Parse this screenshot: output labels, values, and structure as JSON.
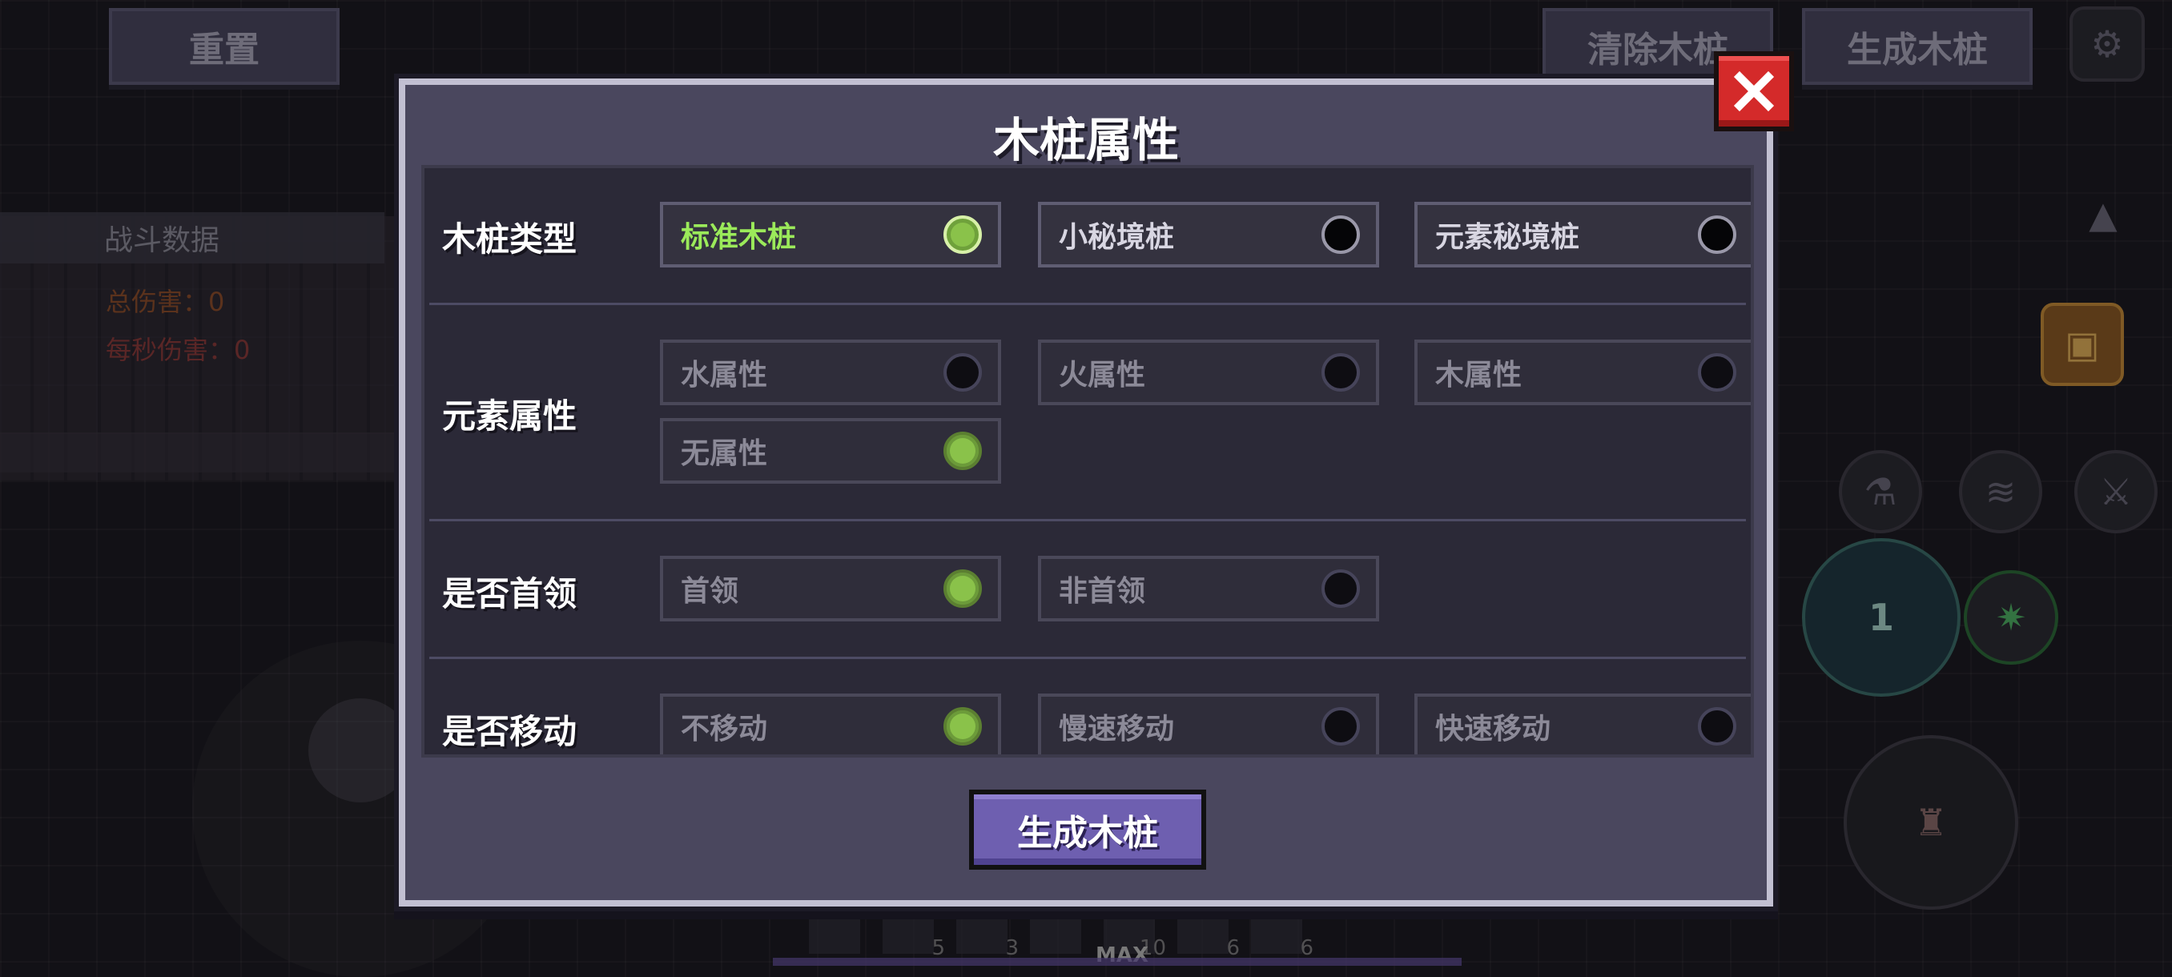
{
  "top_bar": {
    "reset_label": "重置",
    "clear_label": "清除木桩",
    "spawn_label": "生成木桩"
  },
  "stats": {
    "title": "战斗数据",
    "total_damage": "总伤害：0",
    "dps": "每秒伤害：0"
  },
  "hud": {
    "skill_level": "1",
    "hotbar_counts": [
      "5",
      "3",
      "10",
      "6",
      "6"
    ],
    "max_label": "MAX"
  },
  "dialog": {
    "title": "木桩属性",
    "generate_label": "生成木桩",
    "rows": [
      {
        "label": "木桩类型",
        "options": [
          {
            "label": "标准木桩",
            "selected": true,
            "enabled": true
          },
          {
            "label": "小秘境桩",
            "selected": false,
            "enabled": true
          },
          {
            "label": "元素秘境桩",
            "selected": false,
            "enabled": true
          }
        ]
      },
      {
        "label": "元素属性",
        "options": [
          {
            "label": "水属性",
            "selected": false,
            "enabled": false
          },
          {
            "label": "火属性",
            "selected": false,
            "enabled": false
          },
          {
            "label": "木属性",
            "selected": false,
            "enabled": false
          },
          {
            "label": "无属性",
            "selected": true,
            "enabled": false
          }
        ]
      },
      {
        "label": "是否首领",
        "options": [
          {
            "label": "首领",
            "selected": true,
            "enabled": false
          },
          {
            "label": "非首领",
            "selected": false,
            "enabled": false
          }
        ]
      },
      {
        "label": "是否移动",
        "options": [
          {
            "label": "不移动",
            "selected": true,
            "enabled": false
          },
          {
            "label": "慢速移动",
            "selected": false,
            "enabled": false
          },
          {
            "label": "快速移动",
            "selected": false,
            "enabled": false
          }
        ]
      }
    ]
  },
  "colors": {
    "selected_radio": "#8ac24a",
    "selected_text": "#9bea5a",
    "close_button": "#d42a2a",
    "primary_button": "#6e5fb0"
  }
}
